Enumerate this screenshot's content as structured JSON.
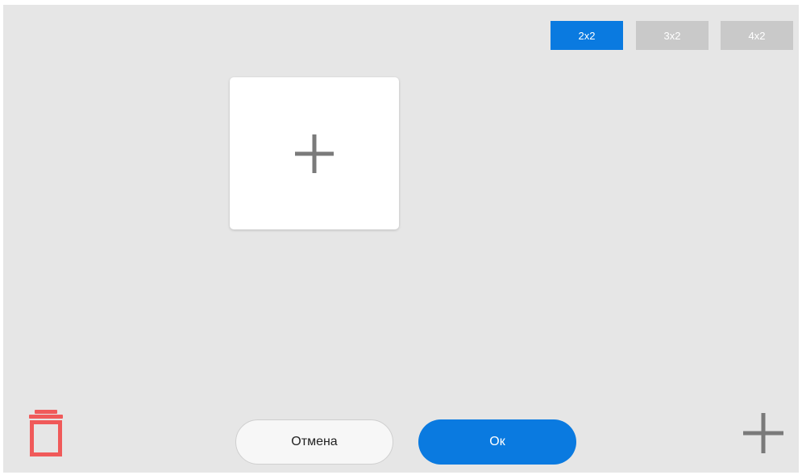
{
  "layout_options": [
    {
      "label": "2x2",
      "active": true
    },
    {
      "label": "3x2",
      "active": false
    },
    {
      "label": "4x2",
      "active": false
    }
  ],
  "tile": {
    "icon": "plus-icon"
  },
  "footer": {
    "delete_icon": "trash-icon",
    "cancel_label": "Отмена",
    "ok_label": "Ок",
    "add_icon": "plus-icon"
  },
  "colors": {
    "background": "#e6e6e6",
    "accent": "#0a7ae0",
    "inactive": "#c9c9c9",
    "delete": "#f05a5a",
    "icon_gray": "#7a7a7a"
  }
}
